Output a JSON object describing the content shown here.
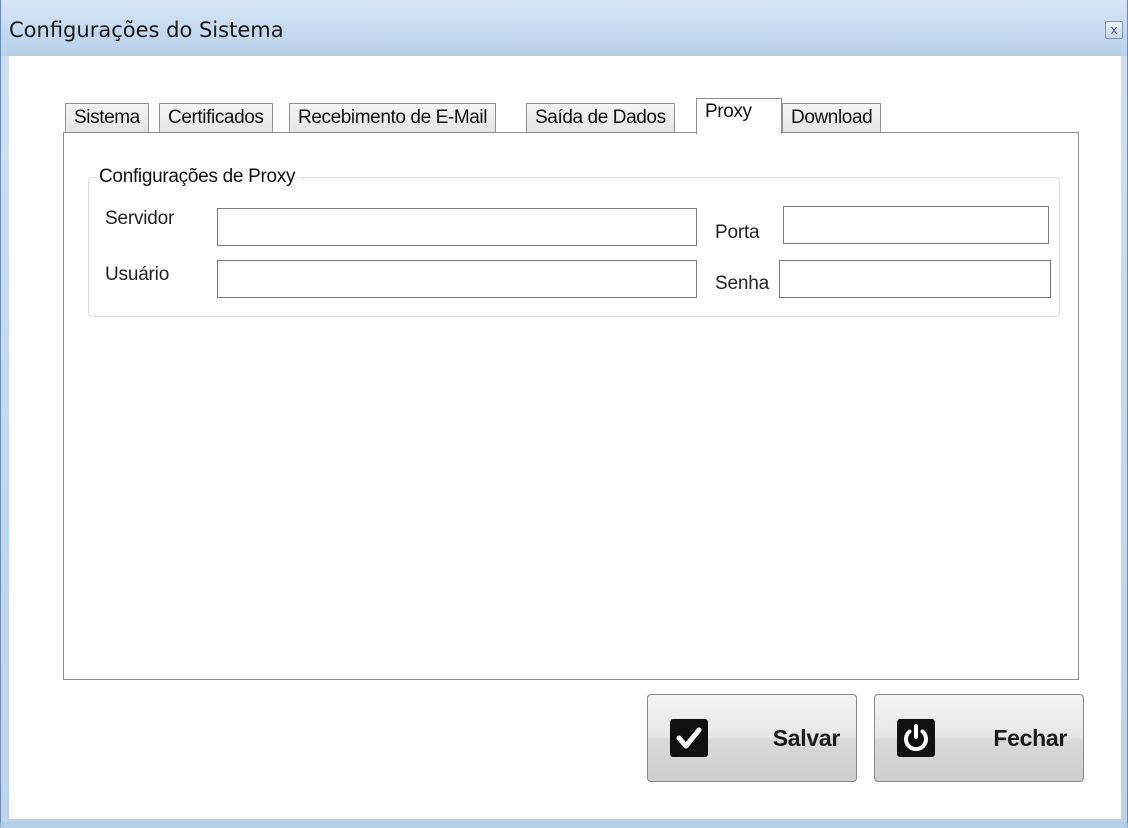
{
  "window": {
    "title": "Configurações do Sistema",
    "close_glyph": "x"
  },
  "tabs": [
    {
      "label": "Sistema",
      "active": false
    },
    {
      "label": "Certificados",
      "active": false
    },
    {
      "label": "Recebimento de E-Mail",
      "active": false
    },
    {
      "label": "Saída de Dados",
      "active": false
    },
    {
      "label": "Proxy",
      "active": true
    },
    {
      "label": "Download",
      "active": false
    }
  ],
  "proxy_group": {
    "legend": "Configurações de Proxy",
    "servidor_label": "Servidor",
    "servidor_value": "",
    "porta_label": "Porta",
    "porta_value": "",
    "usuario_label": "Usuário",
    "usuario_value": "",
    "senha_label": "Senha",
    "senha_value": ""
  },
  "buttons": {
    "save_label": "Salvar",
    "save_icon": "checkmark-icon",
    "close_label": "Fechar",
    "close_icon": "power-icon"
  }
}
